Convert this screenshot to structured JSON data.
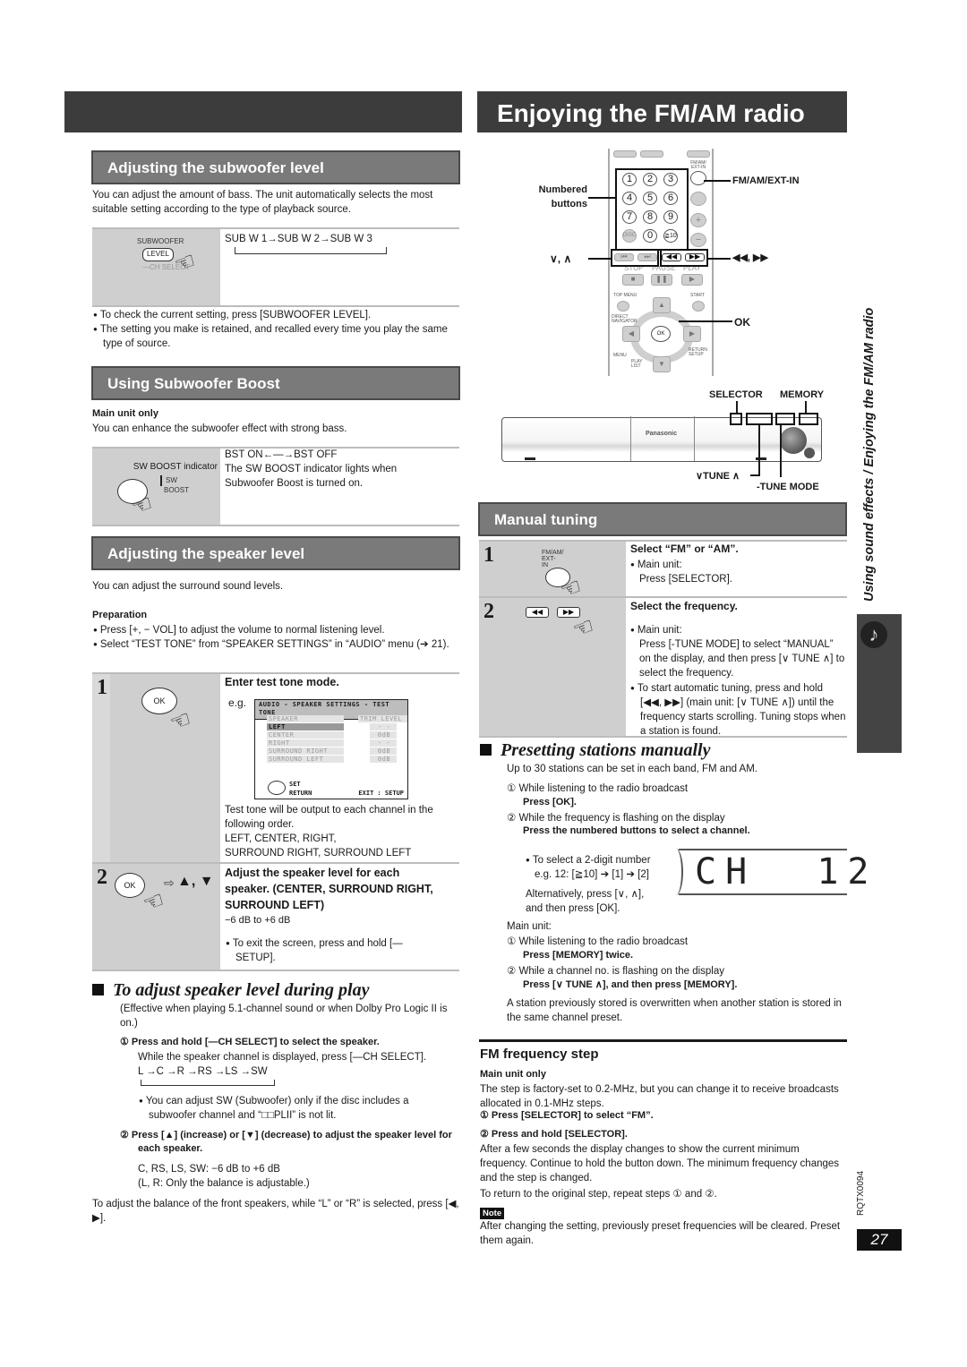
{
  "page": {
    "title": "Enjoying the FM/AM radio",
    "side_tab_text": "Using sound effects / Enjoying the FM/AM radio",
    "doc_code": "RQTX0094",
    "page_number": "27"
  },
  "subwoofer_level": {
    "heading": "Adjusting the subwoofer level",
    "intro": "You can adjust the amount of bass. The unit automatically selects the most suitable setting according to the type of playback source.",
    "button_top_label": "SUBWOOFER",
    "button_label": "LEVEL",
    "button_sub_label": "—CH SELECT",
    "sequence": "SUB W 1→SUB W 2→SUB W 3",
    "notes": [
      "To check the current setting, press [SUBWOOFER LEVEL].",
      "The setting you make is retained, and recalled every time you play the same type of source."
    ]
  },
  "subwoofer_boost": {
    "heading": "Using Subwoofer Boost",
    "main_unit_only": "Main unit only",
    "intro": "You can enhance the subwoofer effect with strong bass.",
    "indicator_label": "SW BOOST indicator",
    "indicator_small_1": "SW",
    "indicator_small_2": "BOOST",
    "toggle": "BST ON←—→BST OFF",
    "description": "The SW BOOST indicator lights when Subwoofer Boost is turned on."
  },
  "speaker_level": {
    "heading": "Adjusting the speaker level",
    "intro": "You can adjust the surround sound levels.",
    "preparation_label": "Preparation",
    "preparation": [
      "Press [+, − VOL] to adjust the volume to normal listening level.",
      "Select “TEST TONE” from “SPEAKER SETTINGS” in “AUDIO” menu (➔ 21)."
    ],
    "step1": {
      "number": "1",
      "button": "OK",
      "title": "Enter test tone mode.",
      "eg": "e.g.",
      "screen": {
        "title": "AUDIO - SPEAKER SETTINGS - TEST TONE",
        "col_speaker": "SPEAKER",
        "col_trim": "TRIM LEVEL",
        "rows": [
          {
            "name": "LEFT",
            "value": "- -",
            "selected": true
          },
          {
            "name": "CENTER",
            "value": "0dB",
            "selected": false
          },
          {
            "name": "RIGHT",
            "value": "- -",
            "selected": false
          },
          {
            "name": "SURROUND RIGHT",
            "value": "0dB",
            "selected": false
          },
          {
            "name": "SURROUND LEFT",
            "value": "0dB",
            "selected": false
          }
        ],
        "set": "SET",
        "return": "RETURN",
        "exit": "EXIT : SETUP"
      },
      "description_1": "Test tone will be output to each channel in the following order.",
      "description_2": "LEFT, CENTER, RIGHT,",
      "description_3": "SURROUND RIGHT, SURROUND LEFT"
    },
    "step2": {
      "number": "2",
      "button": "OK",
      "arrows": "▲, ▼",
      "title": "Adjust the speaker level for each speaker. (CENTER, SURROUND RIGHT, SURROUND LEFT)",
      "range": "−6 dB to +6 dB",
      "note": "To exit the screen, press and hold [—SETUP]."
    }
  },
  "during_play": {
    "heading": "To adjust speaker level during play",
    "effective": "(Effective when playing 5.1-channel sound or when Dolby Pro Logic II is on.)",
    "step1_title": "① Press and hold [—CH SELECT] to select the speaker.",
    "step1_text": "While the speaker channel is displayed, press [—CH SELECT].",
    "step1_sequence": "L →C →R →RS →LS →SW",
    "step1_note": "You can adjust SW (Subwoofer) only if the disc includes a subwoofer channel and “□□PLII” is not lit.",
    "step2_title": "② Press [▲] (increase) or [▼] (decrease) to adjust the speaker level for each speaker.",
    "step2_range": "C, RS, LS, SW: −6 dB to +6 dB",
    "step2_note": "(L, R: Only the balance is adjustable.)",
    "balance": "To adjust the balance of the front speakers, while “L” or “R” is selected, press [◀, ▶]."
  },
  "remote_diagram": {
    "callout_numbered": "Numbered buttons",
    "callout_fm": "FM/AM/EXT-IN",
    "callout_skip": "∨, ∧",
    "callout_search": "◀◀, ▶▶",
    "callout_ok": "OK",
    "numbers": [
      "1",
      "2",
      "3",
      "4",
      "5",
      "6",
      "7",
      "8",
      "9",
      "0",
      "≧10"
    ],
    "fm_key_label": "FM/AM/ EXT-IN",
    "stop": "STOP",
    "pause": "PAUSE",
    "play": "PLAY",
    "top_menu": "TOP MENU",
    "start": "START",
    "direct_nav": "DIRECT NAVIGATOR",
    "menu": "MENU",
    "playlist": "PLAY LIST",
    "return_setup": "RETURN SETUP",
    "ok": "OK"
  },
  "unit_diagram": {
    "selector": "SELECTOR",
    "memory": "MEMORY",
    "tune": "∨TUNE ∧",
    "tune_mode": "-TUNE MODE",
    "brand": "Panasonic"
  },
  "manual_tuning": {
    "heading": "Manual tuning",
    "step1": {
      "number": "1",
      "key_label": "FM/AM/ EXT-IN",
      "title": "Select “FM” or “AM”.",
      "main_unit": "Main unit:",
      "text": "Press [SELECTOR]."
    },
    "step2": {
      "number": "2",
      "title": "Select the frequency.",
      "main_unit": "Main unit:",
      "text": "Press [-TUNE MODE] to select “MANUAL” on the display, and then press [∨ TUNE ∧] to select the frequency.",
      "auto": "To start automatic tuning, press and hold [◀◀, ▶▶] (main unit: [∨ TUNE ∧]) until the frequency starts scrolling. Tuning stops when a station is found."
    }
  },
  "presetting": {
    "heading": "Presetting stations manually",
    "intro": "Up to 30 stations can be set in each band, FM and AM.",
    "step1_text": "① While listening to the radio broadcast",
    "step1_bold": "Press [OK].",
    "step2_text": "② While the frequency is flashing on the display",
    "step2_bold": "Press the numbered buttons to select a channel.",
    "two_digit_1": "To select a 2-digit number",
    "two_digit_2": "e.g. 12: [≧10] ➔ [1] ➔ [2]",
    "alt_1": "Alternatively, press [∨, ∧],",
    "alt_2": "and then press [OK].",
    "lcd": "CH  12",
    "main_unit": "Main unit:",
    "mu_step1_text": "① While listening to the radio broadcast",
    "mu_step1_bold": "Press [MEMORY] twice.",
    "mu_step2_text": "② While a channel no. is flashing on the display",
    "mu_step2_bold": "Press [∨ TUNE ∧], and then press [MEMORY].",
    "overwrite": "A station previously stored is overwritten when another station is stored in the same channel preset."
  },
  "fm_step": {
    "heading": "FM frequency step",
    "main_unit_only": "Main unit only",
    "intro": "The step is factory-set to 0.2-MHz, but you can change it to receive broadcasts allocated in 0.1-MHz steps.",
    "step1": "① Press [SELECTOR] to select “FM”.",
    "step2": "② Press and hold [SELECTOR].",
    "after": "After a few seconds the display changes to show the current minimum frequency. Continue to hold the button down. The minimum frequency changes and the step is changed.",
    "return": "To return to the original step, repeat steps ① and ②.",
    "note_label": "Note",
    "note": "After changing the setting, previously preset frequencies will be cleared. Preset them again."
  }
}
